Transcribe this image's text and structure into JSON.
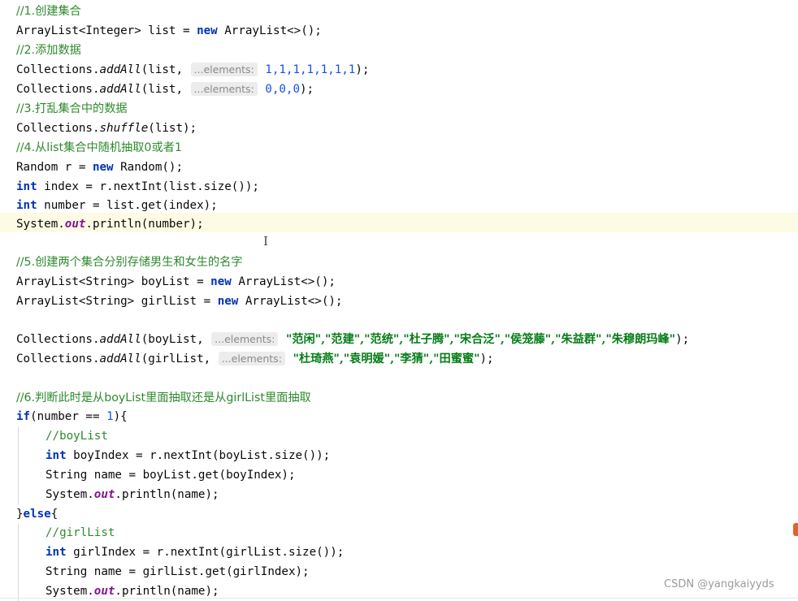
{
  "code": {
    "c1": "//1.创建集合",
    "l2_type": "ArrayList<Integer> list = ",
    "kw_new": "new",
    "l2_rest": " ArrayList<>();",
    "c2": "//2.添加数据",
    "collections": "Collections.",
    "addAll": "addAll",
    "open_list": "(list,",
    "hint_elements": "...elements:",
    "l4_nums": "1,1,1,1,1,1,1",
    "l5_nums": "0,0,0",
    "close_stmt": ");",
    "c3": "//3.打乱集合中的数据",
    "shuffle": "shuffle",
    "shuffle_args": "(list);",
    "c4": "//4.从list集合中随机抽取0或者1",
    "l10_a": "Random r = ",
    "l10_b": " Random();",
    "kw_int": "int",
    "l11_rest": " index = r.nextInt(list.size());",
    "l12_rest": " number = list.get(index);",
    "system": "System.",
    "out": "out",
    "l13_rest": ".println(number);",
    "c5": "//5.创建两个集合分别存储男生和女生的名字",
    "l16_a": "ArrayList<String> boyList = ",
    "l17_a": "ArrayList<String> girlList = ",
    "l_arr_rest": " ArrayList<>();",
    "open_boy": "(boyList,",
    "open_girl": "(girlList,",
    "boy_names": "\"范闲\",\"范建\",\"范统\",\"杜子腾\",\"宋合泛\",\"侯笼藤\",\"朱益群\",\"朱穆朗玛峰\"",
    "girl_names": "\"杜琦燕\",\"袁明媛\",\"李猜\",\"田蜜蜜\"",
    "c6": "//6.判断此时是从boyList里面抽取还是从girlList里面抽取",
    "kw_if": "if",
    "if_a": "(number == ",
    "if_num": "1",
    "if_b": "){",
    "c_boy": "//boyList",
    "boy_idx": " boyIndex = r.nextInt(boyList.size());",
    "boy_name": "String name = boyList.get(boyIndex);",
    "println_name": ".println(name);",
    "brace_close": "}",
    "kw_else": "else",
    "brace_open": "{",
    "c_girl": "//girlList",
    "girl_idx": " girlIndex = r.nextInt(girlList.size());",
    "girl_name": "String name = girlList.get(girlIndex);"
  },
  "cursor_glyph": "I",
  "watermark": "CSDN @yangkaiyyds",
  "colors": {
    "keyword": "#0033b3",
    "comment": "#2e8a2e",
    "number": "#1750eb",
    "string": "#067d17",
    "field": "#871094",
    "highlight": "#fdfbe4"
  }
}
